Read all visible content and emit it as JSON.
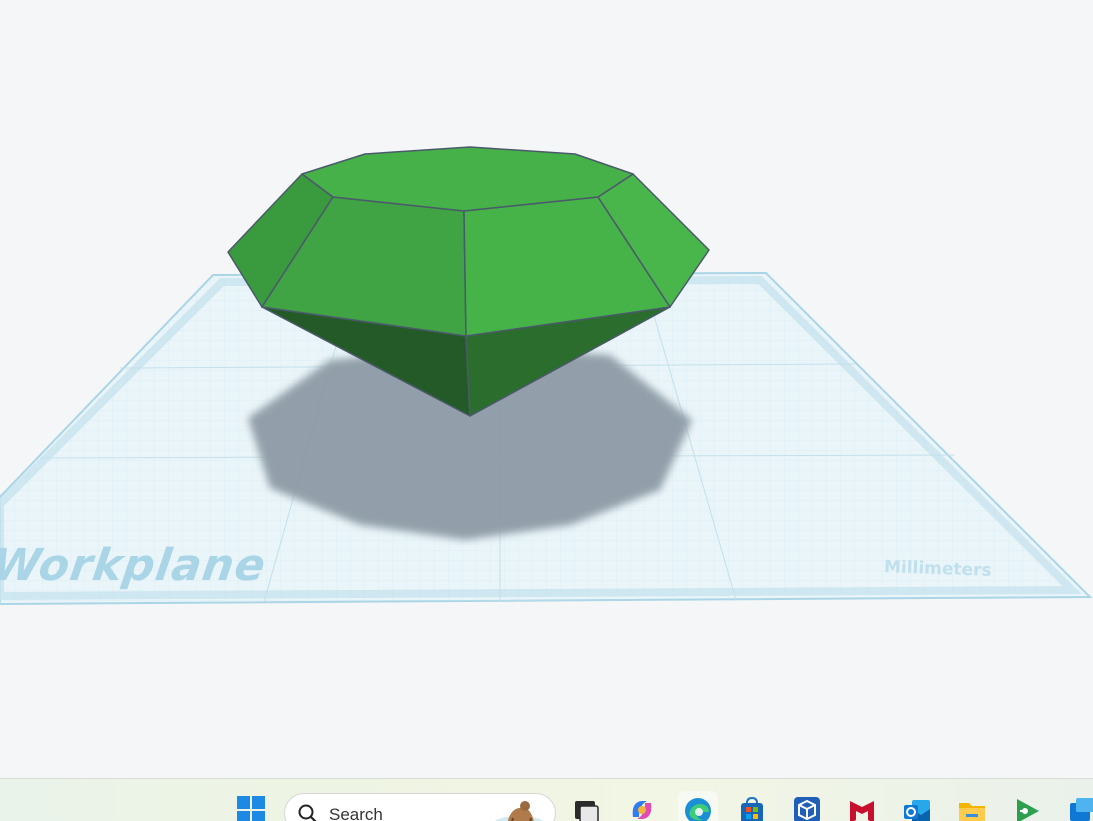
{
  "viewport": {
    "workplane_label": "Workplane",
    "unit_label": "Millimeters",
    "colors": {
      "background": "#f5f6f7",
      "grid": "#bfe1ee",
      "grid_border": "#a9d5e6",
      "shape_green": "#43a846",
      "shadow": "#8e9ba6"
    }
  },
  "taskbar": {
    "search_placeholder": "Search",
    "icons": [
      "windows-start-icon",
      "search-icon",
      "task-view-icon",
      "copilot-icon",
      "edge-browser-icon",
      "microsoft-store-icon",
      "app-cube-icon",
      "mcafee-icon",
      "outlook-icon",
      "file-explorer-icon",
      "game-app-icon",
      "window-app-icon"
    ]
  }
}
